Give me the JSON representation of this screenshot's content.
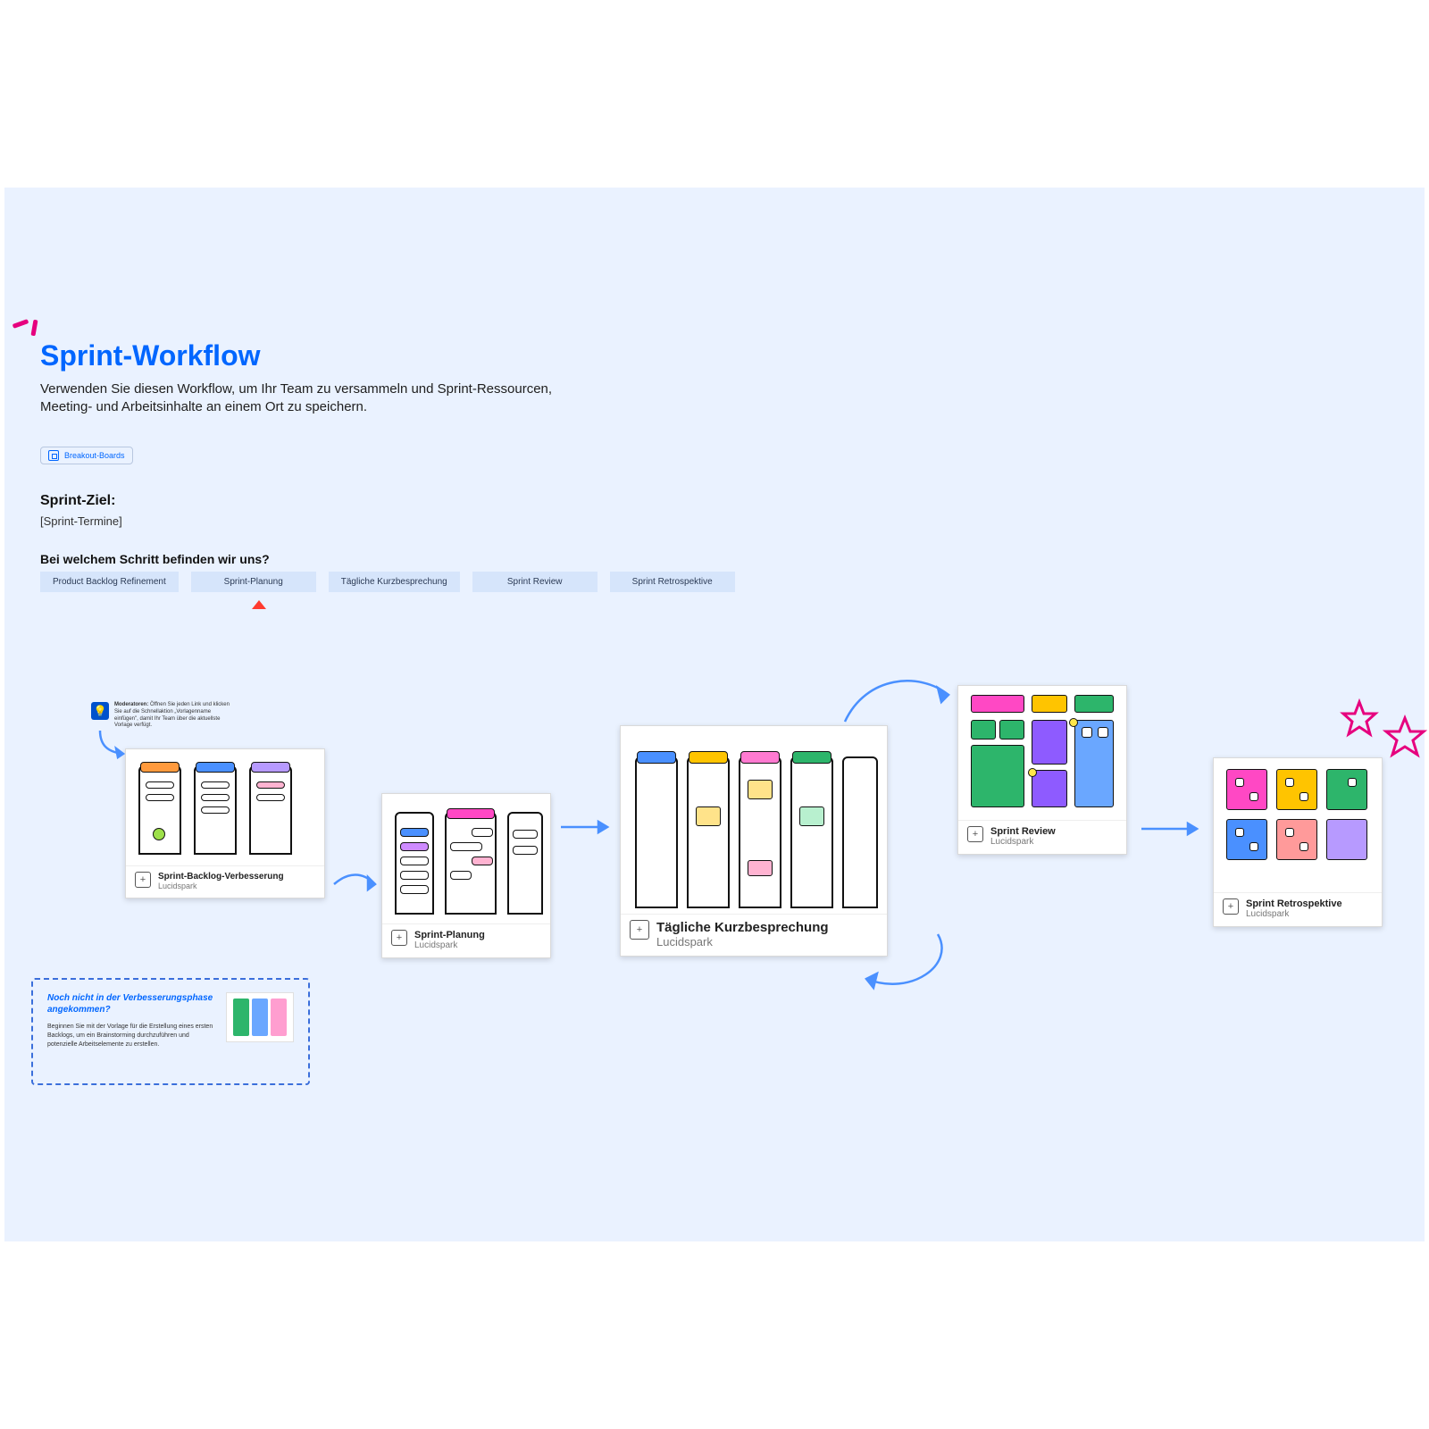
{
  "title": "Sprint-Workflow",
  "subtitle": "Verwenden Sie diesen Workflow, um Ihr Team zu versammeln und Sprint-Ressourcen, Meeting- und Arbeitsinhalte an einem Ort zu speichern.",
  "breakout_button": "Breakout-Boards",
  "sprint_goal_label": "Sprint-Ziel:",
  "sprint_dates": "[Sprint-Termine]",
  "step_question": "Bei welchem Schritt befinden wir uns?",
  "steps": [
    "Product Backlog Refinement",
    "Sprint-Planung",
    "Tägliche Kurzbesprechung",
    "Sprint Review",
    "Sprint Retrospektive"
  ],
  "selected_step_index": 1,
  "tip": {
    "label": "Moderatoren:",
    "body": "Öffnen Sie jeden Link und klicken Sie auf die Schnellaktion „Vorlagenname einfügen\", damit Ihr Team über die aktuellste Vorlage verfügt."
  },
  "cards": {
    "backlog": {
      "title": "Sprint-Backlog-Verbesserung",
      "source": "Lucidspark"
    },
    "planning": {
      "title": "Sprint-Planung",
      "source": "Lucidspark"
    },
    "daily": {
      "title": "Tägliche Kurzbesprechung",
      "source": "Lucidspark"
    },
    "review": {
      "title": "Sprint Review",
      "source": "Lucidspark"
    },
    "retro": {
      "title": "Sprint Retrospektive",
      "source": "Lucidspark"
    }
  },
  "hint": {
    "title": "Noch nicht in der Verbesserungsphase angekommen?",
    "body": "Beginnen Sie mit der Vorlage für die Erstellung eines ersten Backlogs, um ein Brainstorming durchzuführen und potenzielle Arbeitselemente zu erstellen."
  },
  "colors": {
    "accent": "#0066ff",
    "chip_bg": "#d6e5fb",
    "magenta": "#e6007e",
    "arrow": "#4a90ff"
  }
}
